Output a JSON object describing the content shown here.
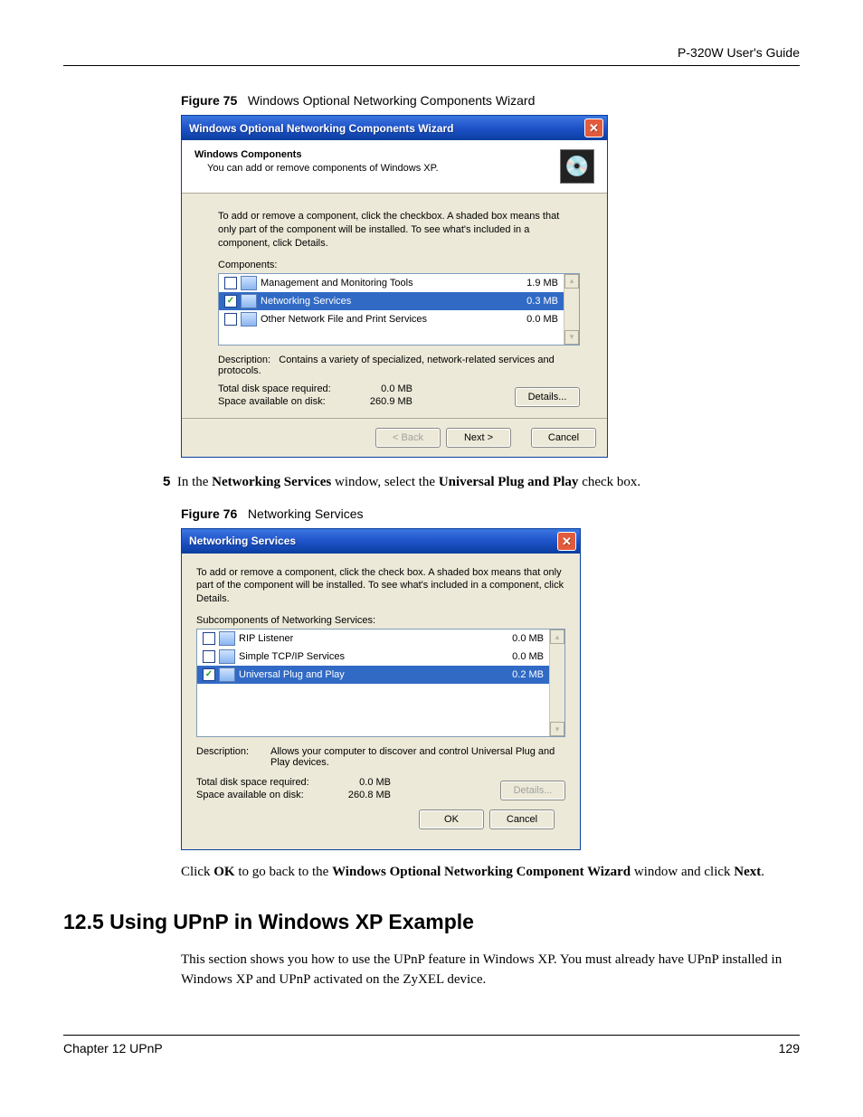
{
  "page": {
    "guide_title": "P-320W User's Guide",
    "footer_left": "Chapter 12 UPnP",
    "footer_right": "129"
  },
  "fig75": {
    "caption_label": "Figure 75",
    "caption_text": "Windows Optional Networking Components Wizard",
    "title": "Windows Optional Networking Components Wizard",
    "banner_heading": "Windows Components",
    "banner_sub": "You can add or remove components of Windows XP.",
    "instructions": "To add or remove a component, click the checkbox. A shaded box means that only part of the component will be installed. To see what's included in a component, click Details.",
    "list_label": "Components:",
    "items": [
      {
        "name": "Management and Monitoring Tools",
        "size": "1.9 MB",
        "checked": false,
        "selected": false
      },
      {
        "name": "Networking Services",
        "size": "0.3 MB",
        "checked": true,
        "selected": true
      },
      {
        "name": "Other Network File and Print Services",
        "size": "0.0 MB",
        "checked": false,
        "selected": false
      }
    ],
    "description_label": "Description:",
    "description": "Contains a variety of specialized, network-related services and protocols.",
    "disk_required_label": "Total disk space required:",
    "disk_required": "0.0 MB",
    "disk_available_label": "Space available on disk:",
    "disk_available": "260.9 MB",
    "buttons": {
      "details": "Details...",
      "back": "< Back",
      "next": "Next >",
      "cancel": "Cancel"
    }
  },
  "step5": {
    "num": "5",
    "text_plain_1": "In the ",
    "text_bold_1": "Networking Services",
    "text_plain_2": " window, select the ",
    "text_bold_2": "Universal Plug and Play",
    "text_plain_3": " check box."
  },
  "fig76": {
    "caption_label": "Figure 76",
    "caption_text": "Networking Services",
    "title": "Networking Services",
    "instructions": "To add or remove a component, click the check box. A shaded box means that only part of the component will be installed. To see what's included in a component, click Details.",
    "list_label": "Subcomponents of Networking Services:",
    "items": [
      {
        "name": "RIP Listener",
        "size": "0.0 MB",
        "checked": false,
        "selected": false
      },
      {
        "name": "Simple TCP/IP Services",
        "size": "0.0 MB",
        "checked": false,
        "selected": false
      },
      {
        "name": "Universal Plug and Play",
        "size": "0.2 MB",
        "checked": true,
        "selected": true
      }
    ],
    "description_label": "Description:",
    "description": "Allows your computer to discover and control Universal Plug and Play devices.",
    "disk_required_label": "Total disk space required:",
    "disk_required": "0.0 MB",
    "disk_available_label": "Space available on disk:",
    "disk_available": "260.8 MB",
    "buttons": {
      "details": "Details...",
      "ok": "OK",
      "cancel": "Cancel"
    }
  },
  "para_after": {
    "p1": "Click ",
    "b1": "OK",
    "p2": " to go back to the ",
    "b2": "Windows Optional Networking Component Wizard",
    "p3": " window and click ",
    "b3": "Next",
    "p4": "."
  },
  "section": {
    "heading": "12.5   Using UPnP in Windows XP Example",
    "body": "This section shows you how to use the UPnP feature in Windows XP. You must already have UPnP installed in Windows XP and UPnP activated on the ZyXEL device."
  }
}
